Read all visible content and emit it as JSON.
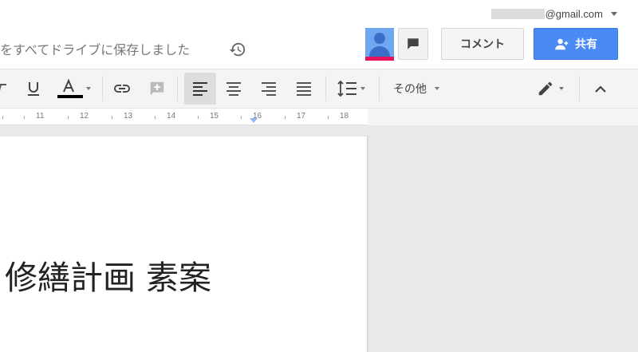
{
  "account": {
    "email_suffix": "@gmail.com"
  },
  "header": {
    "save_status": "をすべてドライブに保存しました",
    "comment_label": "コメント",
    "share_label": "共有"
  },
  "toolbar": {
    "more_label": "その他"
  },
  "ruler": {
    "numbers": [
      "11",
      "12",
      "13",
      "14",
      "15",
      "16",
      "17",
      "18"
    ]
  },
  "document": {
    "title": "修繕計画 素案"
  },
  "colors": {
    "share_button": "#4a8af4",
    "presence_bar": "#e8115e",
    "avatar": "#6fa8f0",
    "active_align_bg": "#dddddd"
  }
}
